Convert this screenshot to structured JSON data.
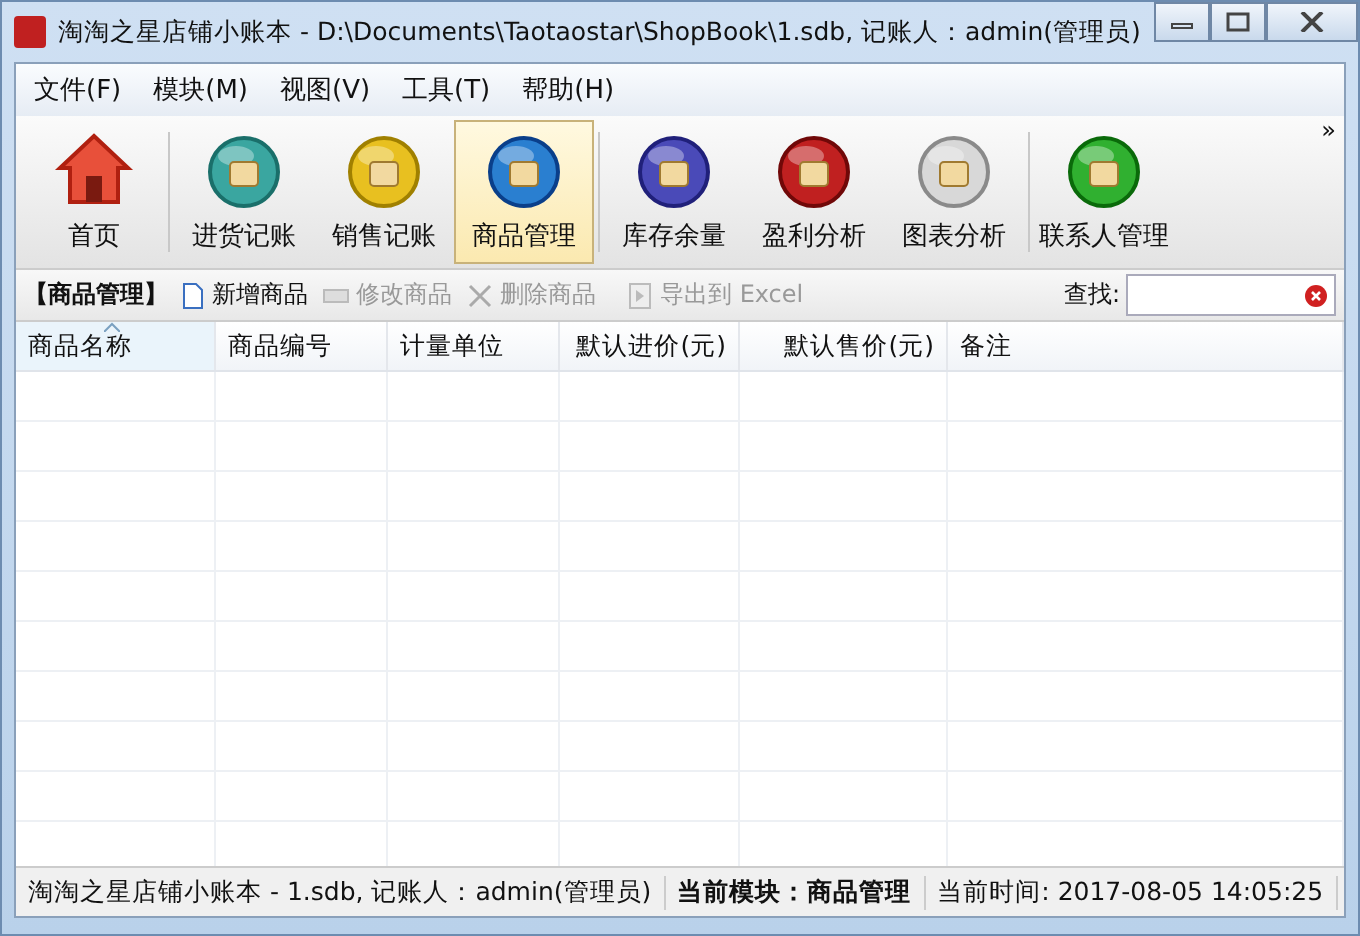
{
  "window": {
    "title": "淘淘之星店铺小账本 - D:\\Documents\\Taotaostar\\ShopBook\\1.sdb, 记账人：admin(管理员)"
  },
  "menu": [
    "文件(F)",
    "模块(M)",
    "视图(V)",
    "工具(T)",
    "帮助(H)"
  ],
  "module_groups": [
    [
      {
        "label": "首页",
        "selected": false
      }
    ],
    [
      {
        "label": "进货记账",
        "selected": false
      },
      {
        "label": "销售记账",
        "selected": false
      },
      {
        "label": "商品管理",
        "selected": true
      }
    ],
    [
      {
        "label": "库存余量",
        "selected": false
      },
      {
        "label": "盈利分析",
        "selected": false
      },
      {
        "label": "图表分析",
        "selected": false
      }
    ],
    [
      {
        "label": "联系人管理",
        "selected": false
      }
    ]
  ],
  "overflow": "»",
  "section_title": "【商品管理】",
  "actions": [
    {
      "label": "新增商品",
      "disabled": false
    },
    {
      "label": "修改商品",
      "disabled": true
    },
    {
      "label": "删除商品",
      "disabled": true
    },
    {
      "label": "导出到 Excel",
      "disabled": true
    }
  ],
  "search": {
    "label": "查找:"
  },
  "table": {
    "columns": [
      {
        "label": "商品名称",
        "sorted": true
      },
      {
        "label": "商品编号",
        "sorted": false
      },
      {
        "label": "计量单位",
        "sorted": false
      },
      {
        "label": "默认进价(元)",
        "sorted": false
      },
      {
        "label": "默认售价(元)",
        "sorted": false
      },
      {
        "label": "备注",
        "sorted": false
      }
    ]
  },
  "status_bar": [
    {
      "text": "淘淘之星店铺小账本 - 1.sdb, 记账人：admin(管理员)",
      "bold": false
    },
    {
      "text": "当前模块：商品管理",
      "bold": true
    },
    {
      "text": "当前时间: 2017-08-05 14:05:25",
      "bold": false
    }
  ]
}
